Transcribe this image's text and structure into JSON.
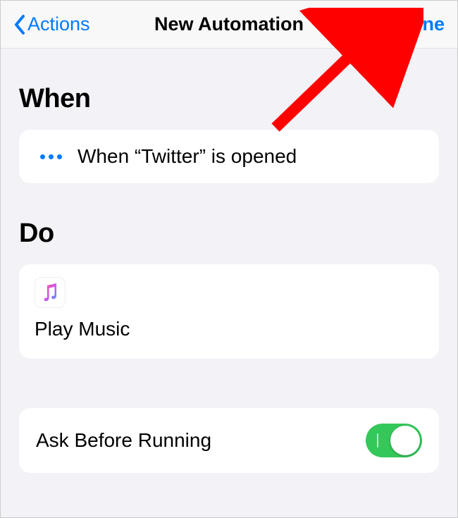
{
  "nav": {
    "back_label": "Actions",
    "title": "New Automation",
    "done_label": "Done"
  },
  "sections": {
    "when_header": "When",
    "do_header": "Do"
  },
  "when": {
    "description": "When “Twitter” is opened"
  },
  "do": {
    "action_title": "Play Music",
    "app_icon": "music-app-icon"
  },
  "settings": {
    "ask_before_running_label": "Ask Before Running",
    "ask_before_running_on": true
  },
  "colors": {
    "ios_blue": "#007aff",
    "ios_green": "#34c759",
    "annotation_red": "#ff0000"
  }
}
